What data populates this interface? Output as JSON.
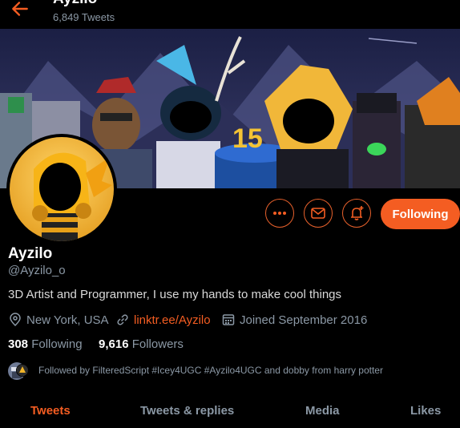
{
  "header": {
    "title": "Ayzilo",
    "tweet_count": "6,849 Tweets"
  },
  "profile": {
    "name": "Ayzilo",
    "handle": "@Ayzilo_o",
    "bio": "3D Artist and Programmer, I use my hands to make cool things",
    "location": "New York, USA",
    "website": "linktr.ee/Ayzilo",
    "joined": "Joined September 2016",
    "following_count": "308",
    "following_label": "Following",
    "followers_count": "9,616",
    "followers_label": "Followers",
    "followed_by": "Followed by FilteredScript #Icey4UGC #Ayzilo4UGC and dobby from harry potter"
  },
  "actions": {
    "follow_label": "Following"
  },
  "tabs": [
    "Tweets",
    "Tweets & replies",
    "Media",
    "Likes"
  ],
  "banner_cake_text": "15",
  "colors": {
    "accent": "#f45d22",
    "background": "#000000",
    "muted": "#8b98a5"
  }
}
